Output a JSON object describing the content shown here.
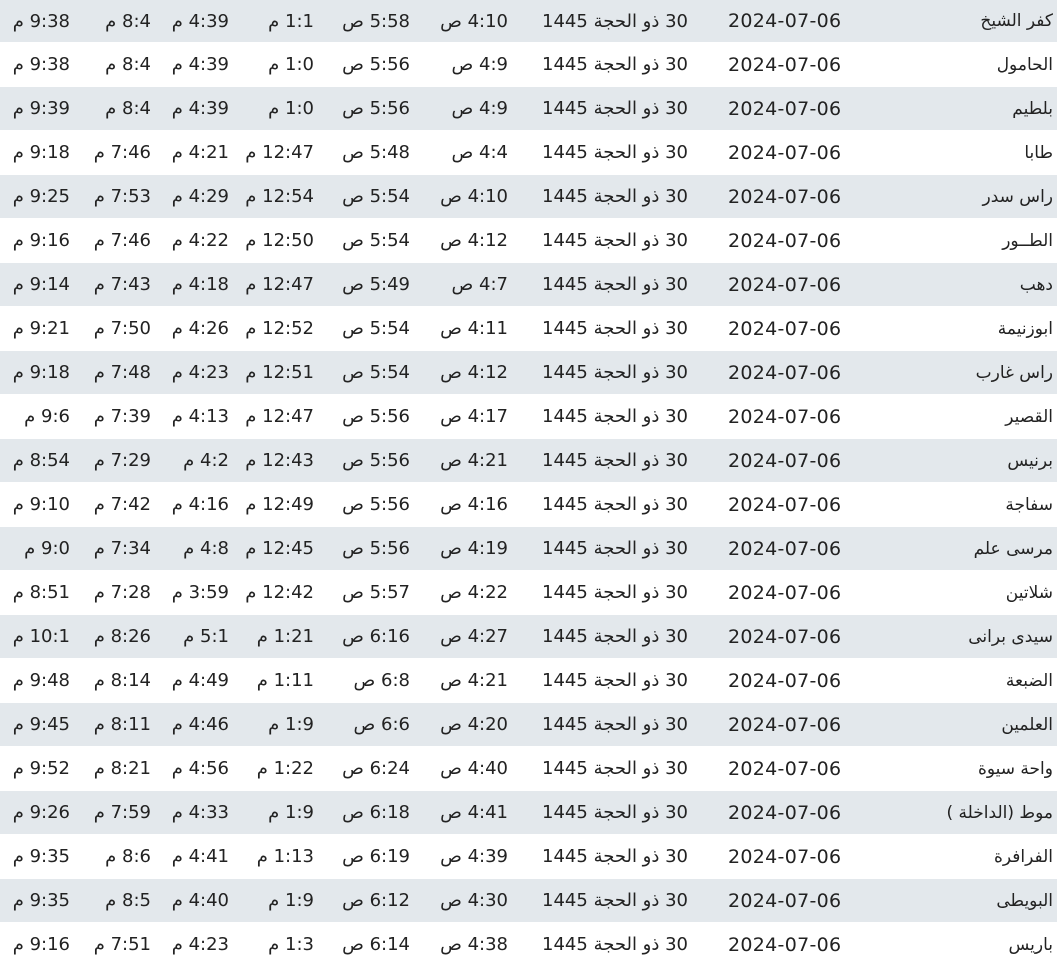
{
  "rows": [
    {
      "city": "كفر الشيخ",
      "date": "2024-07-06",
      "hijri": "30 ذو الحجة 1445",
      "fajr": "4:10 ص",
      "sunrise": "5:58 ص",
      "dhuhr": "1:1 م",
      "asr": "4:39 م",
      "maghrib": "8:4 م",
      "isha": "9:38 م"
    },
    {
      "city": "الحامول",
      "date": "2024-07-06",
      "hijri": "30 ذو الحجة 1445",
      "fajr": "4:9 ص",
      "sunrise": "5:56 ص",
      "dhuhr": "1:0 م",
      "asr": "4:39 م",
      "maghrib": "8:4 م",
      "isha": "9:38 م"
    },
    {
      "city": "بلطيم",
      "date": "2024-07-06",
      "hijri": "30 ذو الحجة 1445",
      "fajr": "4:9 ص",
      "sunrise": "5:56 ص",
      "dhuhr": "1:0 م",
      "asr": "4:39 م",
      "maghrib": "8:4 م",
      "isha": "9:39 م"
    },
    {
      "city": "طابا",
      "date": "2024-07-06",
      "hijri": "30 ذو الحجة 1445",
      "fajr": "4:4 ص",
      "sunrise": "5:48 ص",
      "dhuhr": "12:47 م",
      "asr": "4:21 م",
      "maghrib": "7:46 م",
      "isha": "9:18 م"
    },
    {
      "city": "راس سدر",
      "date": "2024-07-06",
      "hijri": "30 ذو الحجة 1445",
      "fajr": "4:10 ص",
      "sunrise": "5:54 ص",
      "dhuhr": "12:54 م",
      "asr": "4:29 م",
      "maghrib": "7:53 م",
      "isha": "9:25 م"
    },
    {
      "city": "الطــور",
      "date": "2024-07-06",
      "hijri": "30 ذو الحجة 1445",
      "fajr": "4:12 ص",
      "sunrise": "5:54 ص",
      "dhuhr": "12:50 م",
      "asr": "4:22 م",
      "maghrib": "7:46 م",
      "isha": "9:16 م"
    },
    {
      "city": "دهب",
      "date": "2024-07-06",
      "hijri": "30 ذو الحجة 1445",
      "fajr": "4:7 ص",
      "sunrise": "5:49 ص",
      "dhuhr": "12:47 م",
      "asr": "4:18 م",
      "maghrib": "7:43 م",
      "isha": "9:14 م"
    },
    {
      "city": "ابوزنيمة",
      "date": "2024-07-06",
      "hijri": "30 ذو الحجة 1445",
      "fajr": "4:11 ص",
      "sunrise": "5:54 ص",
      "dhuhr": "12:52 م",
      "asr": "4:26 م",
      "maghrib": "7:50 م",
      "isha": "9:21 م"
    },
    {
      "city": "راس غارب",
      "date": "2024-07-06",
      "hijri": "30 ذو الحجة 1445",
      "fajr": "4:12 ص",
      "sunrise": "5:54 ص",
      "dhuhr": "12:51 م",
      "asr": "4:23 م",
      "maghrib": "7:48 م",
      "isha": "9:18 م"
    },
    {
      "city": "القصير",
      "date": "2024-07-06",
      "hijri": "30 ذو الحجة 1445",
      "fajr": "4:17 ص",
      "sunrise": "5:56 ص",
      "dhuhr": "12:47 م",
      "asr": "4:13 م",
      "maghrib": "7:39 م",
      "isha": "9:6 م"
    },
    {
      "city": "برنيس",
      "date": "2024-07-06",
      "hijri": "30 ذو الحجة 1445",
      "fajr": "4:21 ص",
      "sunrise": "5:56 ص",
      "dhuhr": "12:43 م",
      "asr": "4:2 م",
      "maghrib": "7:29 م",
      "isha": "8:54 م"
    },
    {
      "city": "سفاجة",
      "date": "2024-07-06",
      "hijri": "30 ذو الحجة 1445",
      "fajr": "4:16 ص",
      "sunrise": "5:56 ص",
      "dhuhr": "12:49 م",
      "asr": "4:16 م",
      "maghrib": "7:42 م",
      "isha": "9:10 م"
    },
    {
      "city": "مرسى علم",
      "date": "2024-07-06",
      "hijri": "30 ذو الحجة 1445",
      "fajr": "4:19 ص",
      "sunrise": "5:56 ص",
      "dhuhr": "12:45 م",
      "asr": "4:8 م",
      "maghrib": "7:34 م",
      "isha": "9:0 م"
    },
    {
      "city": "شلاتين",
      "date": "2024-07-06",
      "hijri": "30 ذو الحجة 1445",
      "fajr": "4:22 ص",
      "sunrise": "5:57 ص",
      "dhuhr": "12:42 م",
      "asr": "3:59 م",
      "maghrib": "7:28 م",
      "isha": "8:51 م"
    },
    {
      "city": "سيدى برانى",
      "date": "2024-07-06",
      "hijri": "30 ذو الحجة 1445",
      "fajr": "4:27 ص",
      "sunrise": "6:16 ص",
      "dhuhr": "1:21 م",
      "asr": "5:1 م",
      "maghrib": "8:26 م",
      "isha": "10:1 م"
    },
    {
      "city": "الضبعة",
      "date": "2024-07-06",
      "hijri": "30 ذو الحجة 1445",
      "fajr": "4:21 ص",
      "sunrise": "6:8 ص",
      "dhuhr": "1:11 م",
      "asr": "4:49 م",
      "maghrib": "8:14 م",
      "isha": "9:48 م"
    },
    {
      "city": "العلمين",
      "date": "2024-07-06",
      "hijri": "30 ذو الحجة 1445",
      "fajr": "4:20 ص",
      "sunrise": "6:6 ص",
      "dhuhr": "1:9 م",
      "asr": "4:46 م",
      "maghrib": "8:11 م",
      "isha": "9:45 م"
    },
    {
      "city": "واحة سيوة",
      "date": "2024-07-06",
      "hijri": "30 ذو الحجة 1445",
      "fajr": "4:40 ص",
      "sunrise": "6:24 ص",
      "dhuhr": "1:22 م",
      "asr": "4:56 م",
      "maghrib": "8:21 م",
      "isha": "9:52 م"
    },
    {
      "city": "موط (الداخلة )",
      "date": "2024-07-06",
      "hijri": "30 ذو الحجة 1445",
      "fajr": "4:41 ص",
      "sunrise": "6:18 ص",
      "dhuhr": "1:9 م",
      "asr": "4:33 م",
      "maghrib": "7:59 م",
      "isha": "9:26 م"
    },
    {
      "city": "الفرافرة",
      "date": "2024-07-06",
      "hijri": "30 ذو الحجة 1445",
      "fajr": "4:39 ص",
      "sunrise": "6:19 ص",
      "dhuhr": "1:13 م",
      "asr": "4:41 م",
      "maghrib": "8:6 م",
      "isha": "9:35 م"
    },
    {
      "city": "البويطى",
      "date": "2024-07-06",
      "hijri": "30 ذو الحجة 1445",
      "fajr": "4:30 ص",
      "sunrise": "6:12 ص",
      "dhuhr": "1:9 م",
      "asr": "4:40 م",
      "maghrib": "8:5 م",
      "isha": "9:35 م"
    },
    {
      "city": "باريس",
      "date": "2024-07-06",
      "hijri": "30 ذو الحجة 1445",
      "fajr": "4:38 ص",
      "sunrise": "6:14 ص",
      "dhuhr": "1:3 م",
      "asr": "4:23 م",
      "maghrib": "7:51 م",
      "isha": "9:16 م"
    }
  ]
}
